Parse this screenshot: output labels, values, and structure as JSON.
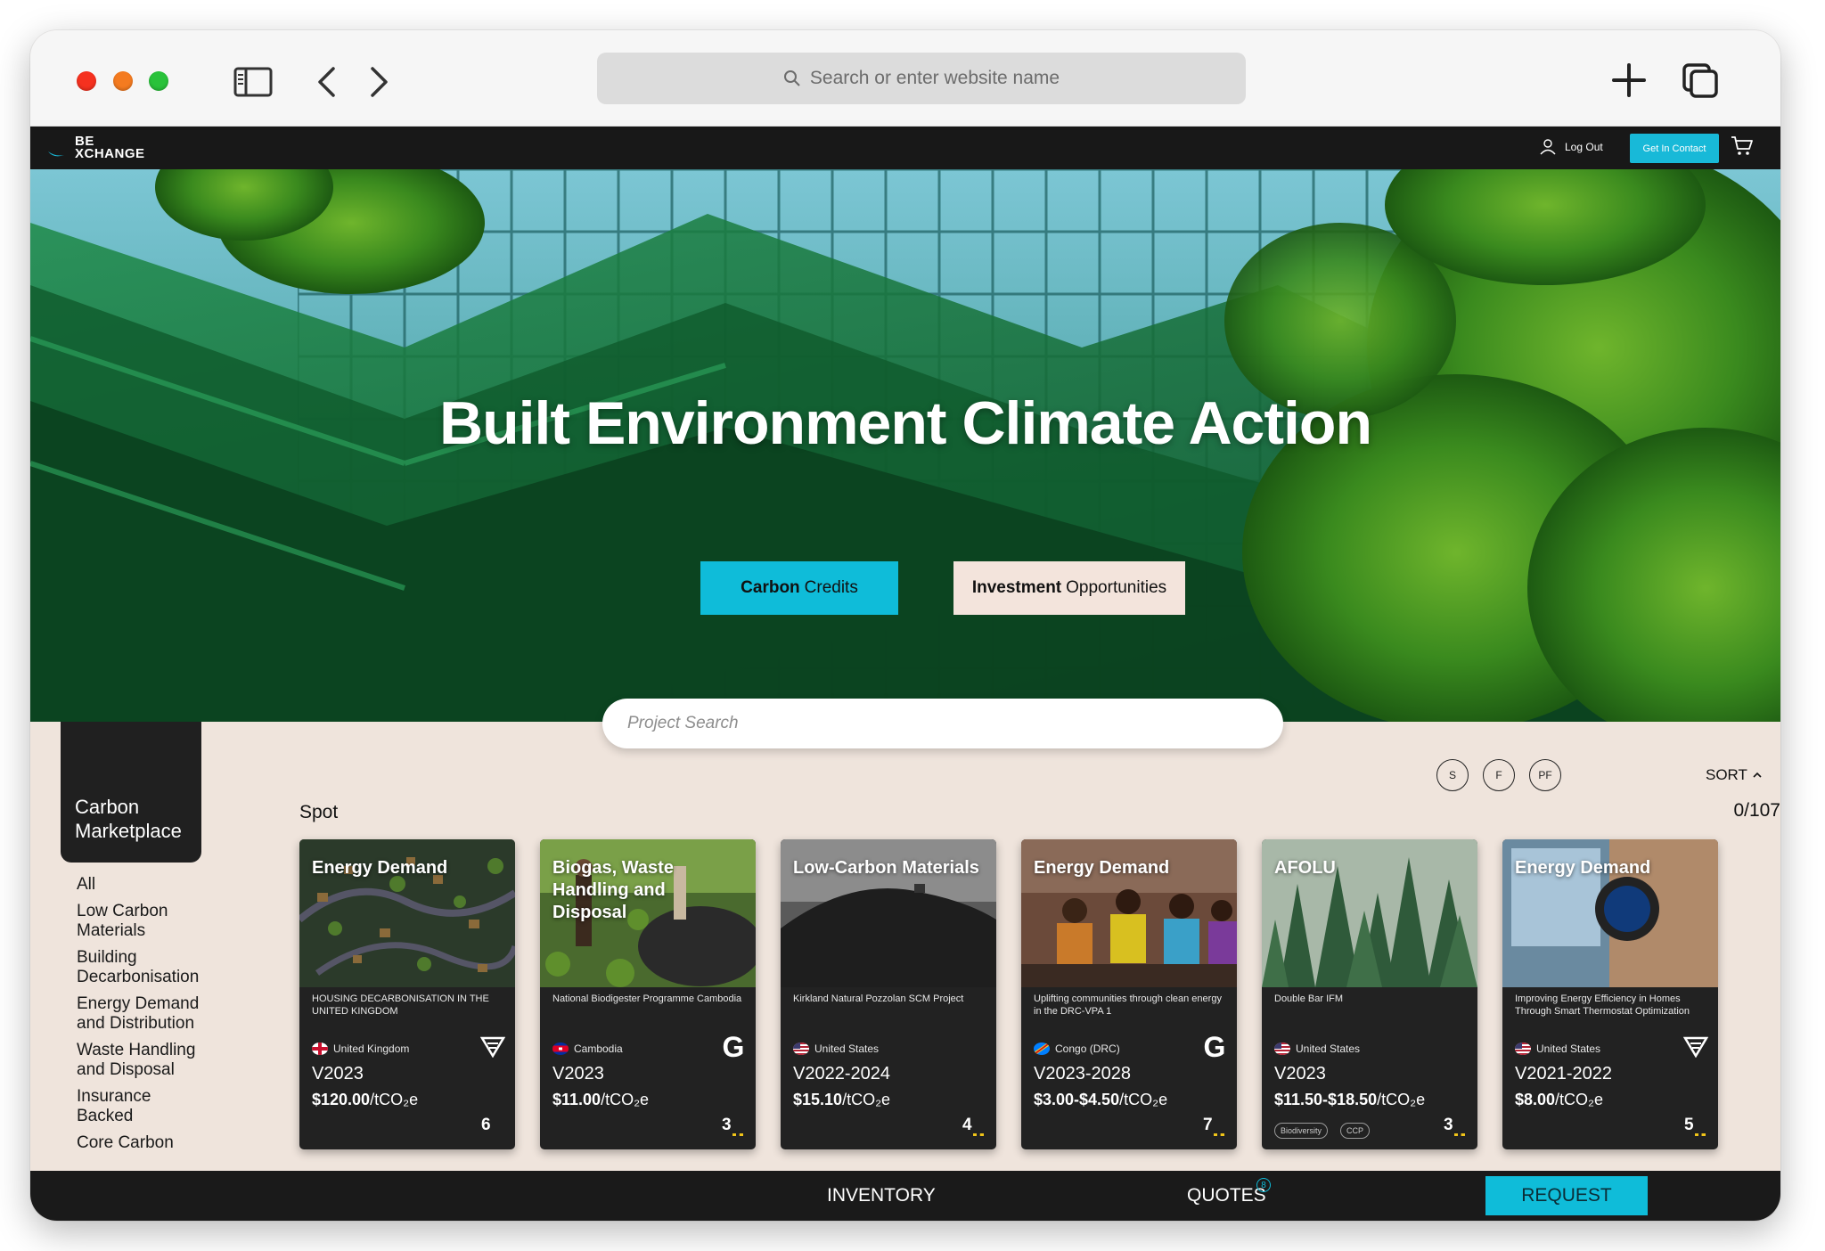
{
  "browser": {
    "address_placeholder": "Search or enter website name"
  },
  "site": {
    "logo_line1": "BE",
    "logo_line2": "XCHANGE",
    "logout_label": "Log Out",
    "contact_label": "Get In Contact"
  },
  "hero": {
    "title": "Built Environment Climate Action",
    "carbon_bold": "Carbon",
    "carbon_rest": "Credits",
    "invest_bold": "Investment",
    "invest_rest": "Opportunities",
    "search_placeholder": "Project Search"
  },
  "sidebar": {
    "heading_line1": "Carbon",
    "heading_line2": "Marketplace",
    "items": [
      "All",
      "Low Carbon\nMaterials",
      "Building\nDecarbonisation",
      "Energy Demand\nand Distribution",
      "Waste Handling\nand Disposal",
      "Insurance\nBacked",
      "Core Carbon"
    ]
  },
  "filters": {
    "s": "S",
    "f": "F",
    "pf": "PF",
    "sort_label": "SORT"
  },
  "listing": {
    "section_label": "Spot",
    "count": "0/107"
  },
  "cards": [
    {
      "type": "Energy Demand",
      "name": "HOUSING DECARBONISATION IN THE UNITED KINGDOM",
      "country": "United Kingdom",
      "vintage": "V2023",
      "price_value": "$120.00",
      "price_unit": "/tCO₂e",
      "logo": "verra",
      "num": "6"
    },
    {
      "type": "Biogas, Waste Handling and Disposal",
      "name": "National Biodigester Programme Cambodia",
      "country": "Cambodia",
      "vintage": "V2023",
      "price_value": "$11.00",
      "price_unit": "/tCO₂e",
      "logo": "G",
      "num": "3"
    },
    {
      "type": "Low-Carbon Materials",
      "name": "Kirkland Natural Pozzolan SCM Project",
      "country": "United States",
      "vintage": "V2022-2024",
      "price_value": "$15.10",
      "price_unit": "/tCO₂e",
      "logo": "",
      "num": "4"
    },
    {
      "type": "Energy Demand",
      "name": "Uplifting communities through clean energy in the DRC-VPA 1",
      "country": "Congo (DRC)",
      "vintage": "V2023-2028",
      "price_value": "$3.00-$4.50",
      "price_unit": "/tCO₂e",
      "logo": "G",
      "num": "7"
    },
    {
      "type": "AFOLU",
      "name": "Double Bar IFM",
      "country": "United States",
      "vintage": "V2023",
      "price_value": "$11.50-$18.50",
      "price_unit": "/tCO₂e",
      "logo": "",
      "num": "3",
      "tags": [
        "Biodiversity",
        "CCP"
      ]
    },
    {
      "type": "Energy Demand",
      "name": "Improving Energy Efficiency in Homes Through Smart Thermostat Optimization",
      "country": "United States",
      "vintage": "V2021-2022",
      "price_value": "$8.00",
      "price_unit": "/tCO₂e",
      "logo": "verra",
      "num": "5"
    }
  ],
  "bottom": {
    "inventory": "INVENTORY",
    "quotes": "QUOTES",
    "quotes_badge": "8",
    "request": "REQUEST"
  },
  "colors": {
    "accent": "#0FBCD9",
    "dark": "#1A1A1A",
    "page_bg": "#EFE4DC"
  }
}
